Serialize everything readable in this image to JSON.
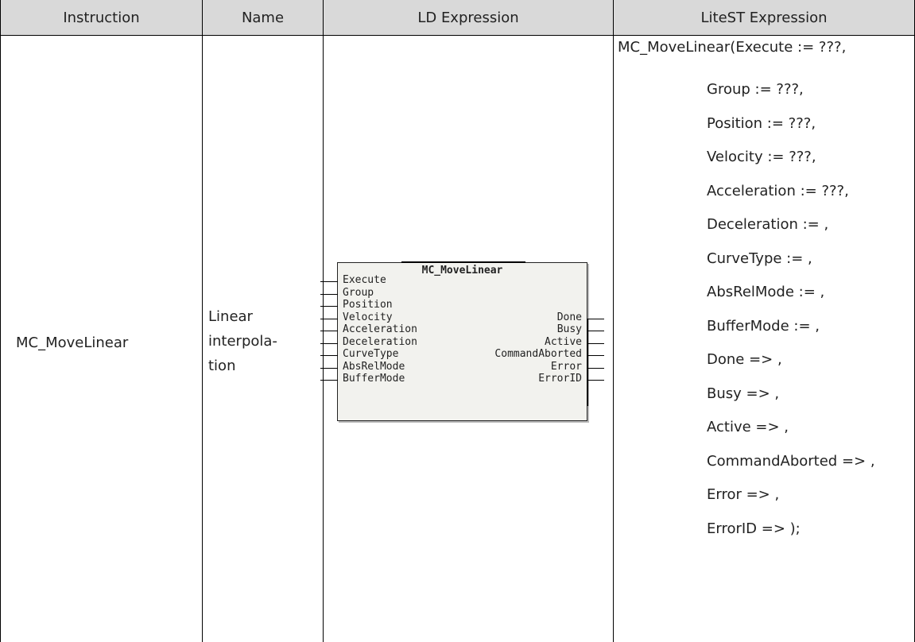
{
  "headers": {
    "instruction": "Instruction",
    "name": "Name",
    "ld": "LD Expression",
    "st": "LiteST Expression"
  },
  "row": {
    "instruction": "MC_MoveLinear",
    "name_lines": [
      "Linear",
      "interpola-",
      "tion"
    ],
    "block": {
      "title": "MC_MoveLinear",
      "inputs": [
        "Execute",
        "Group",
        "Position",
        "Velocity",
        "Acceleration",
        "Deceleration",
        "CurveType",
        "AbsRelMode",
        "BufferMode"
      ],
      "outputs": [
        "Done",
        "Busy",
        "Active",
        "CommandAborted",
        "Error",
        "ErrorID"
      ]
    },
    "st_first": "MC_MoveLinear(Execute := ???,",
    "st_lines": [
      "Group := ???,",
      "Position := ???,",
      "Velocity := ???,",
      "Acceleration := ???,",
      "Deceleration := ,",
      "CurveType := ,",
      "AbsRelMode := ,",
      "BufferMode := ,",
      "Done => ,",
      "Busy => ,",
      "Active => ,",
      "CommandAborted => ,",
      "Error => ,",
      "ErrorID => );"
    ]
  }
}
